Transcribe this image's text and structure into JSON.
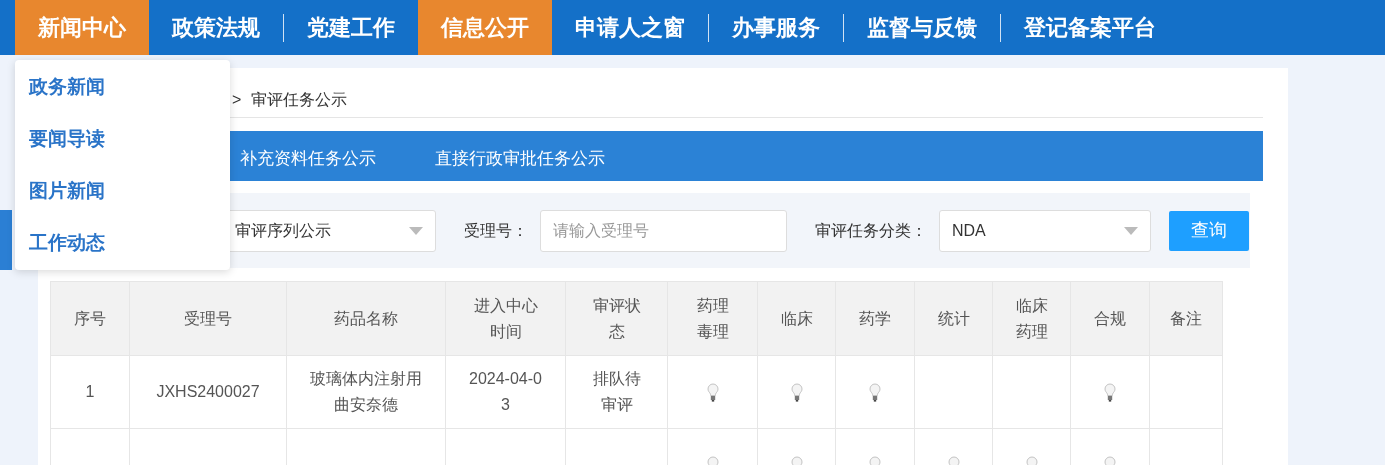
{
  "nav": [
    {
      "label": "新闻中心",
      "selected": true,
      "menu": [
        "政务新闻",
        "要闻导读",
        "图片新闻",
        "工作动态"
      ]
    },
    {
      "label": "政策法规",
      "selected": false
    },
    {
      "label": "党建工作",
      "selected": false
    },
    {
      "label": "信息公开",
      "selected": true
    },
    {
      "label": "申请人之窗",
      "selected": false
    },
    {
      "label": "办事服务",
      "selected": false
    },
    {
      "label": "监督与反馈",
      "selected": false
    },
    {
      "label": "登记备案平台",
      "selected": false
    }
  ],
  "breadcrumb": {
    "separator": ">",
    "current": "审评任务公示"
  },
  "tabs": [
    {
      "label": "补充资料任务公示",
      "selected": false
    },
    {
      "label": "直接行政审批任务公示",
      "selected": false
    }
  ],
  "filters": [
    {
      "kind": "select",
      "value": "审评序列公示"
    },
    {
      "kind": "input",
      "label": "受理号：",
      "placeholder": "请输入受理号"
    },
    {
      "kind": "select",
      "label": "审评任务分类：",
      "value": "NDA"
    }
  ],
  "search_button": "查询",
  "table": {
    "columns": [
      "序号",
      "受理号",
      "药品名称",
      "进入中心时间",
      "审评状态",
      "药理毒理",
      "临床",
      "药学",
      "统计",
      "临床药理",
      "合规",
      "备注"
    ],
    "rows": [
      {
        "cells": [
          "1",
          "JXHS2400027",
          "玻璃体内注射用曲安奈德",
          "2024-04-03",
          "排队待审评"
        ],
        "bulbs": [
          true,
          true,
          true,
          false,
          false,
          true
        ]
      },
      {
        "bulbs": [
          true,
          true,
          true,
          true,
          true,
          true
        ]
      }
    ]
  }
}
